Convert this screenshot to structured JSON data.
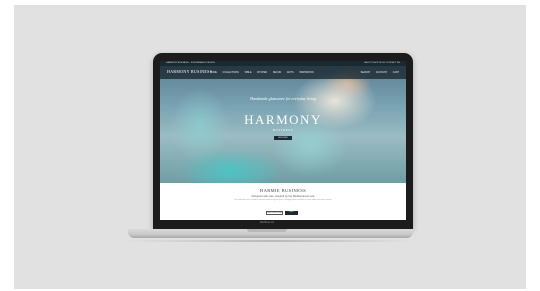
{
  "topbar": {
    "left": "HARMONY BUSINESS · SUSTAINABLE DESIGN",
    "right": "ABOUT   SHOP   BLOG   CONTACT   EN"
  },
  "navbar": {
    "brand": "HARMONY BUSINESS",
    "links": [
      "HOME",
      "COLLECTIONS",
      "TABLE",
      "KITCHEN",
      "DECOR",
      "GIFTS",
      "INSPIRATION"
    ],
    "right": [
      "SEARCH",
      "ACCOUNT",
      "CART"
    ]
  },
  "hero": {
    "tagline": "Handmade glassware for everyday living",
    "title": "HARMONY",
    "subtitle": "BUSINESS",
    "button": "DISCOVER"
  },
  "about": {
    "title": "HARMIE BUSINESS",
    "subtitle": "Designed with care, inspired by the Mediterranean sea",
    "body": "Our collections are crafted by artisans using recycled glass, bringing colour and light to every table and every season.",
    "button_primary": "OUR COLLECTION",
    "button_secondary": "SHOP"
  },
  "device": {
    "label": "MacBook Air"
  }
}
